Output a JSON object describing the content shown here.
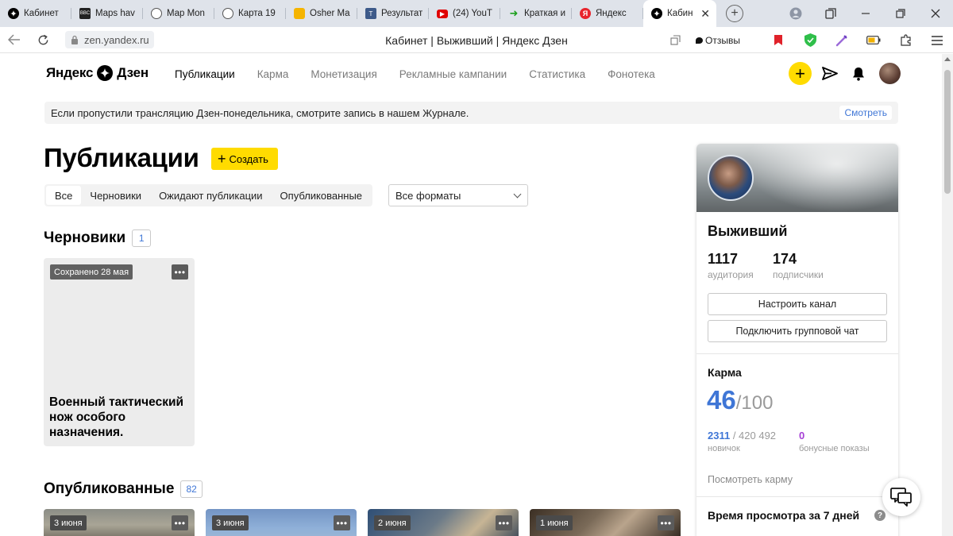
{
  "browser": {
    "tabs": [
      {
        "title": "Кабинет",
        "icon": "zen-icon",
        "color": "#000000"
      },
      {
        "title": "Maps hav",
        "icon": "bbc-icon",
        "color": "#222222"
      },
      {
        "title": "Map Mon",
        "icon": "map-icon",
        "color": "#555555"
      },
      {
        "title": "Карта 19",
        "icon": "map-icon",
        "color": "#555555"
      },
      {
        "title": "Osher Ma",
        "icon": "osher-icon",
        "color": "#f5b400"
      },
      {
        "title": "Результат",
        "icon": "result-icon",
        "color": "#3d5a8a"
      },
      {
        "title": "(24) YouT",
        "icon": "youtube-icon",
        "color": "#e00000"
      },
      {
        "title": "Краткая и",
        "icon": "arrow-icon",
        "color": "#1ea01e"
      },
      {
        "title": "Яндекс",
        "icon": "yandex-icon",
        "color": "#e8242c"
      },
      {
        "title": "Кабин",
        "icon": "zen-icon",
        "color": "#000000"
      }
    ],
    "url": "zen.yandex.ru",
    "page_title": "Кабинет | Выживший | Яндекс Дзен",
    "reviews_label": "Отзывы"
  },
  "header": {
    "logo_left": "Яндекс",
    "logo_right": "Дзен",
    "nav": [
      "Публикации",
      "Карма",
      "Монетизация",
      "Рекламные кампании",
      "Статистика",
      "Фонотека"
    ],
    "active_nav": 0
  },
  "banner": {
    "text": "Если пропустили трансляцию Дзен-понедельника, смотрите запись в нашем Журнале.",
    "button": "Смотреть"
  },
  "main": {
    "title": "Публикации",
    "create_label": "Создать",
    "filters": [
      "Все",
      "Черновики",
      "Ожидают публикации",
      "Опубликованные"
    ],
    "active_filter": 0,
    "format_select": "Все форматы",
    "drafts": {
      "title": "Черновики",
      "count": "1",
      "card": {
        "date": "Сохранено 28 мая",
        "title": "Военный тактический нож особого назначения."
      }
    },
    "published": {
      "title": "Опубликованные",
      "count": "82",
      "cards": [
        {
          "date": "3 июня"
        },
        {
          "date": "3 июня"
        },
        {
          "date": "2 июня"
        },
        {
          "date": "1 июня"
        }
      ]
    }
  },
  "sidebar": {
    "name": "Выживший",
    "audience_value": "1117",
    "audience_label": "аудитория",
    "subscribers_value": "174",
    "subscribers_label": "подписчики",
    "setup_button": "Настроить канал",
    "group_chat_button": "Подключить групповой чат",
    "karma_title": "Карма",
    "karma_value": "46",
    "karma_max": "/100",
    "karma_rank_value": "2311",
    "karma_rank_total": " / 420 492",
    "karma_rank_label": "новичок",
    "bonus_value": "0",
    "bonus_label": "бонусные показы",
    "karma_link": "Посмотреть карму",
    "viewtime_title": "Время просмотра за 7 дней"
  },
  "colors": {
    "accent_yellow": "#ffdb00",
    "link_blue": "#3f76d6",
    "bonus_purple": "#a63fd6"
  }
}
